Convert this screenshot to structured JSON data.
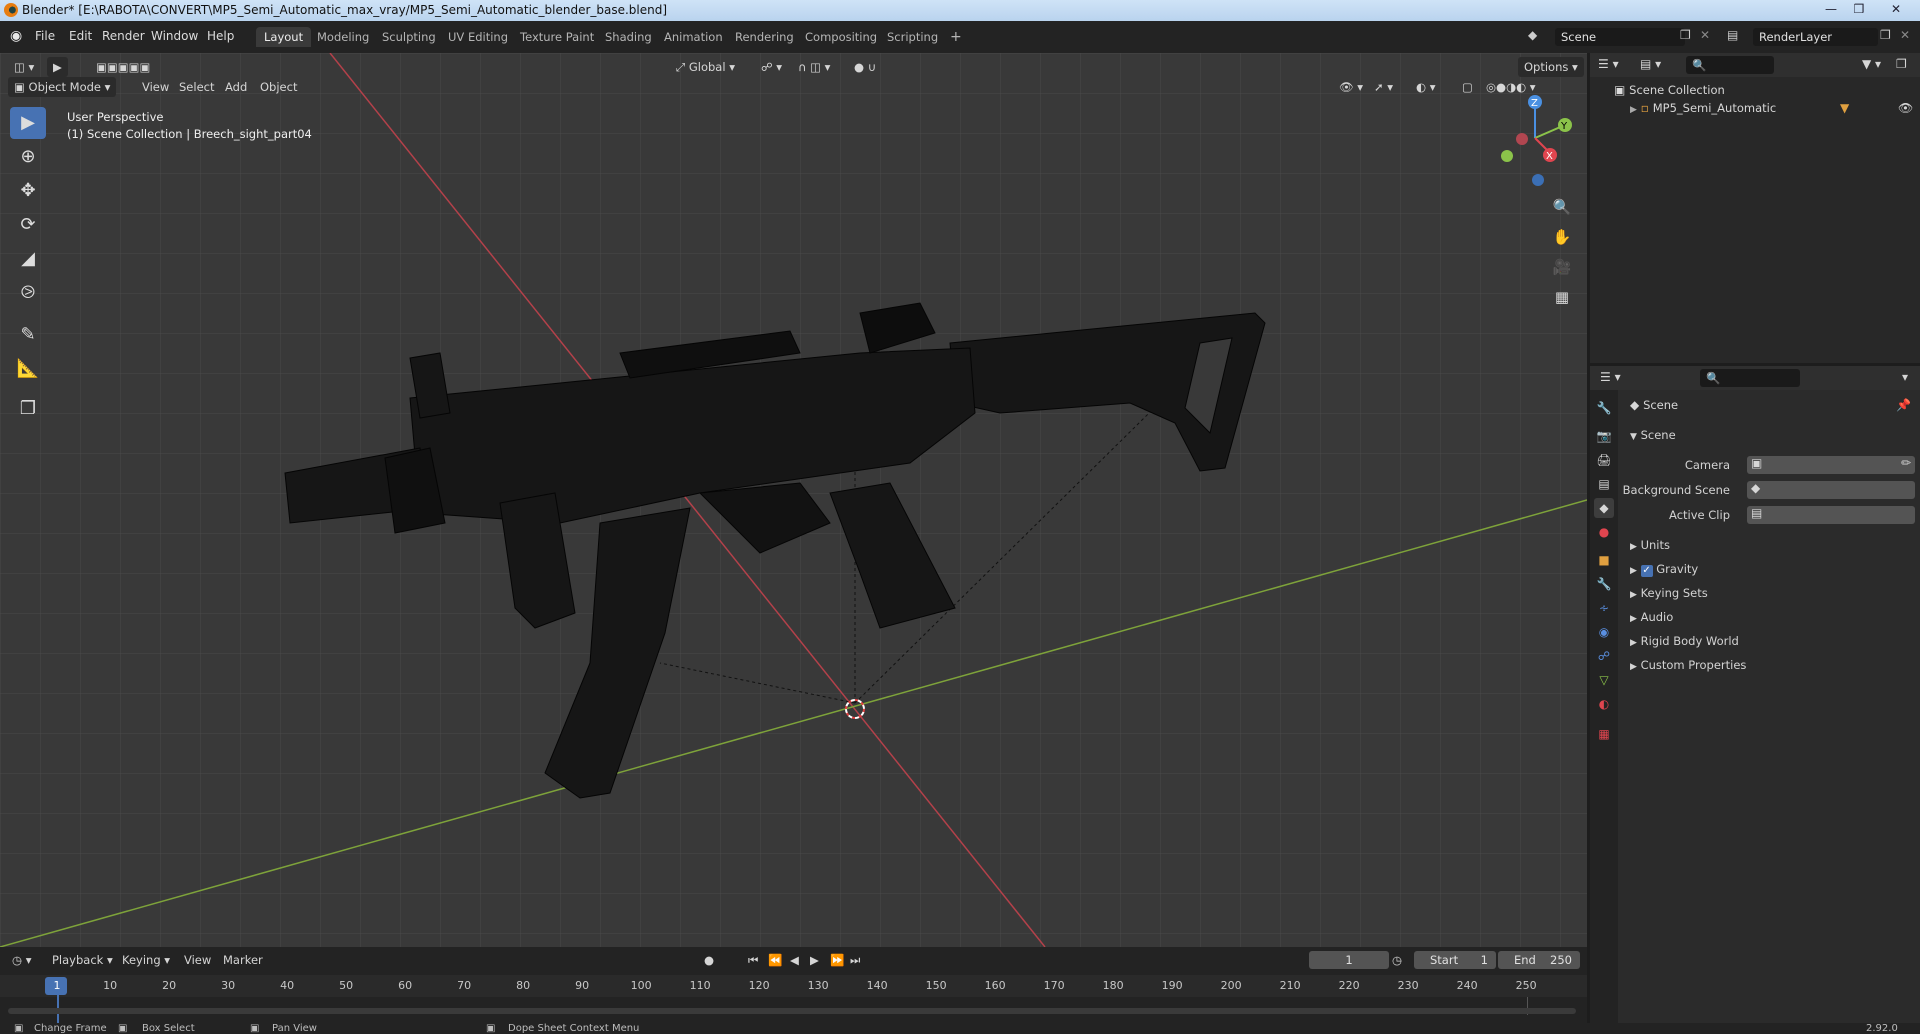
{
  "window": {
    "title": "Blender* [E:\\RABOTA\\CONVERT\\MP5_Semi_Automatic_max_vray/MP5_Semi_Automatic_blender_base.blend]",
    "min": "—",
    "max": "❒",
    "close": "✕"
  },
  "menu": [
    "File",
    "Edit",
    "Render",
    "Window",
    "Help"
  ],
  "workspaces": [
    "Layout",
    "Modeling",
    "Sculpting",
    "UV Editing",
    "Texture Paint",
    "Shading",
    "Animation",
    "Rendering",
    "Compositing",
    "Scripting"
  ],
  "workspace_add": "+",
  "scene_field": "Scene",
  "renderlayer_field": "RenderLayer",
  "viewport": {
    "mode": "Object Mode",
    "menus": [
      "View",
      "Select",
      "Add",
      "Object"
    ],
    "orientation": "Global",
    "options": "Options",
    "perspective": "User Perspective",
    "collection_info": "(1) Scene Collection | Breech_sight_part04",
    "gizmo_axes": [
      "Z",
      "Y",
      "X"
    ]
  },
  "outliner": {
    "root": "Scene Collection",
    "items": [
      "MP5_Semi_Automatic"
    ]
  },
  "properties": {
    "context": "Scene",
    "section": "Scene",
    "fields": [
      {
        "label": "Camera"
      },
      {
        "label": "Background Scene"
      },
      {
        "label": "Active Clip"
      }
    ],
    "panels": [
      "Units",
      "Gravity",
      "Keying Sets",
      "Audio",
      "Rigid Body World",
      "Custom Properties"
    ],
    "gravity_checked": true
  },
  "timeline": {
    "menus": [
      "Playback",
      "Keying",
      "View",
      "Marker"
    ],
    "current_frame": "1",
    "start_label": "Start",
    "start_value": "1",
    "end_label": "End",
    "end_value": "250",
    "ticks": [
      "1",
      "10",
      "20",
      "30",
      "40",
      "50",
      "60",
      "70",
      "80",
      "90",
      "100",
      "110",
      "120",
      "130",
      "140",
      "150",
      "160",
      "170",
      "180",
      "190",
      "200",
      "210",
      "220",
      "230",
      "240",
      "250"
    ]
  },
  "statusbar": {
    "items": [
      "Change Frame",
      "Box Select",
      "Pan View",
      "Dope Sheet Context Menu"
    ],
    "version": "2.92.0"
  },
  "colors": {
    "accent": "#4772b3",
    "x_axis": "#e0454f",
    "y_axis": "#8bc34a",
    "z_axis": "#4a90e2",
    "workspace_active": "#3a3a3a"
  }
}
